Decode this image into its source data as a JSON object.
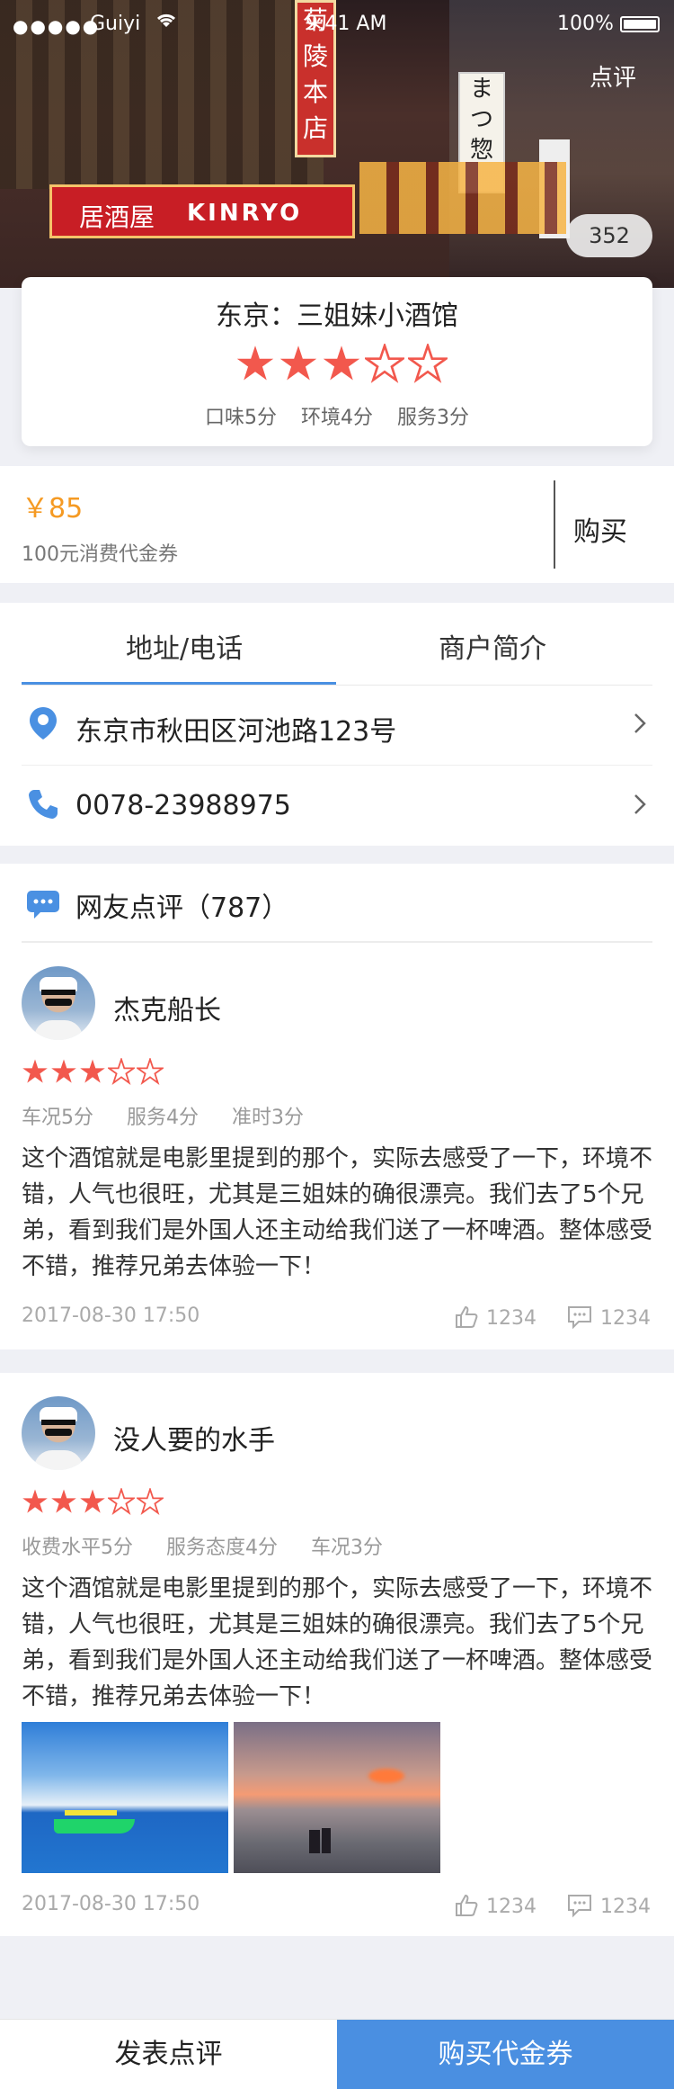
{
  "status_bar": {
    "dots": "●●●●●",
    "carrier": "Guiyi",
    "time": "9:41 AM",
    "battery": "100%"
  },
  "hero": {
    "review_link": "点评",
    "photo_count": "352"
  },
  "store": {
    "title": "东京：三姐妹小酒馆",
    "rating": 3,
    "rating_max": 5,
    "scores": [
      "口味5分",
      "环境4分",
      "服务3分"
    ]
  },
  "voucher": {
    "price": "￥85",
    "desc": "100元消费代金券",
    "buy_label": "购买"
  },
  "info": {
    "tabs": [
      "地址/电话",
      "商户简介"
    ],
    "address": "东京市秋田区河池路123号",
    "phone": "0078-23988975"
  },
  "reviews": {
    "header": "网友点评（787）",
    "items": [
      {
        "name": "杰克船长",
        "rating": 3,
        "tags": [
          "车况5分",
          "服务4分",
          "准时3分"
        ],
        "content": "这个酒馆就是电影里提到的那个，实际去感受了一下，环境不错，人气也很旺，尤其是三姐妹的确很漂亮。我们去了5个兄弟，看到我们是外国人还主动给我们送了一杯啤酒。整体感受不错，推荐兄弟去体验一下！",
        "date": "2017-08-30   17:50",
        "likes": "1234",
        "comments": "1234"
      },
      {
        "name": "没人要的水手",
        "rating": 3,
        "tags": [
          "收费水平5分",
          "服务态度4分",
          "车况3分"
        ],
        "content": "这个酒馆就是电影里提到的那个，实际去感受了一下，环境不错，人气也很旺，尤其是三姐妹的确很漂亮。我们去了5个兄弟，看到我们是外国人还主动给我们送了一杯啤酒。整体感受不错，推荐兄弟去体验一下！",
        "date": "2017-08-30   17:50",
        "likes": "1234",
        "comments": "1234"
      }
    ]
  },
  "bottom_bar": {
    "left": "发表点评",
    "right": "购买代金券"
  },
  "colors": {
    "accent": "#4a90e2",
    "star": "#f2584d",
    "price": "#f59a23",
    "buy_button": "#4a8fe1"
  }
}
